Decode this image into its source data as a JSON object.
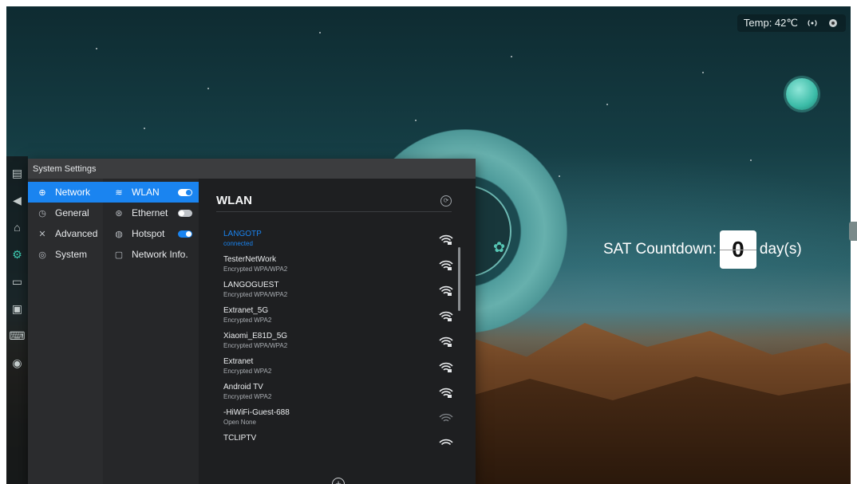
{
  "status": {
    "temp_label": "Temp: 42℃",
    "wifi_icon": "broadcast-icon",
    "extra_icon": "record-icon"
  },
  "countdown": {
    "prefix": "SAT Countdown:",
    "value": "0",
    "suffix": "day(s)"
  },
  "dock": [
    "apps-icon",
    "back-icon",
    "home-icon",
    "settings-icon",
    "folder-icon",
    "screen-icon",
    "keyboard-icon",
    "power-icon"
  ],
  "settings": {
    "title": "System Settings",
    "categories": [
      {
        "label": "Network",
        "icon": "network-icon",
        "selected": true
      },
      {
        "label": "General",
        "icon": "clock-icon",
        "selected": false
      },
      {
        "label": "Advanced",
        "icon": "tools-icon",
        "selected": false
      },
      {
        "label": "System",
        "icon": "system-icon",
        "selected": false
      }
    ],
    "network_items": [
      {
        "label": "WLAN",
        "icon": "wifi-icon",
        "toggle": "on",
        "selected": true
      },
      {
        "label": "Ethernet",
        "icon": "ethernet-icon",
        "toggle": "off",
        "selected": false
      },
      {
        "label": "Hotspot",
        "icon": "hotspot-icon",
        "toggle": "on",
        "selected": false
      },
      {
        "label": "Network Info.",
        "icon": "info-icon",
        "toggle": null,
        "selected": false
      }
    ],
    "wlan": {
      "title": "WLAN",
      "networks": [
        {
          "name": "LANGOTP",
          "status": "connected",
          "signal": "strong",
          "secured": true
        },
        {
          "name": "TesterNetWork",
          "status": "Encrypted WPA/WPA2",
          "signal": "strong",
          "secured": true
        },
        {
          "name": "LANGOGUEST",
          "status": "Encrypted WPA/WPA2",
          "signal": "strong",
          "secured": true
        },
        {
          "name": "Extranet_5G",
          "status": "Encrypted WPA2",
          "signal": "strong",
          "secured": true
        },
        {
          "name": "Xiaomi_E81D_5G",
          "status": "Encrypted WPA/WPA2",
          "signal": "strong",
          "secured": true
        },
        {
          "name": "Extranet",
          "status": "Encrypted WPA2",
          "signal": "strong",
          "secured": true
        },
        {
          "name": "Android TV",
          "status": "Encrypted WPA2",
          "signal": "strong",
          "secured": true
        },
        {
          "name": "-HiWiFi-Guest-688",
          "status": "Open None",
          "signal": "weak",
          "secured": false
        },
        {
          "name": "TCLIPTV",
          "status": "",
          "signal": "strong",
          "secured": true
        }
      ]
    }
  },
  "colors": {
    "accent": "#1a84f0",
    "teal": "#3fcfb5"
  }
}
